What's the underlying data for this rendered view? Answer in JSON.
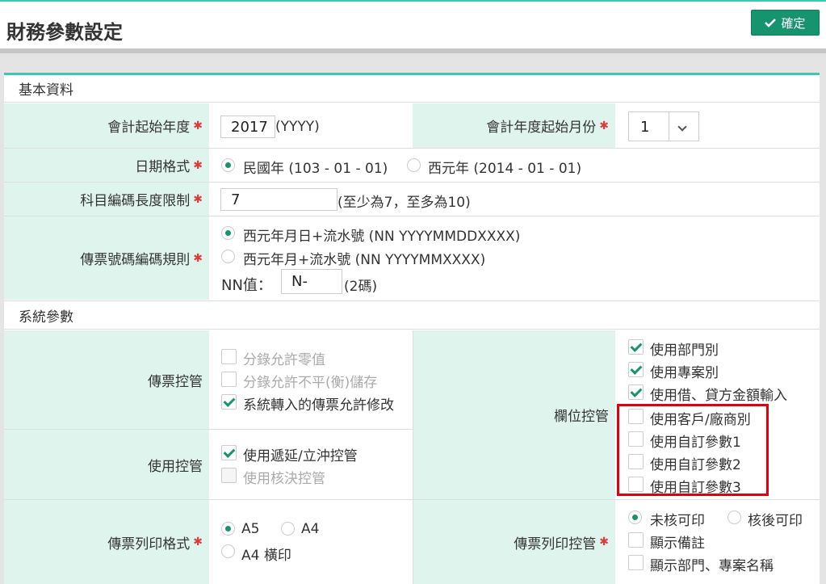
{
  "page": {
    "title": "財務參數設定",
    "confirm_label": "確定"
  },
  "sections": {
    "basic": "基本資料",
    "system": "系統參數"
  },
  "basic": {
    "start_year": {
      "label": "會計起始年度",
      "value": "2017",
      "hint": "(YYYY)"
    },
    "start_month": {
      "label": "會計年度起始月份",
      "value": "1"
    },
    "date_format": {
      "label": "日期格式",
      "options": [
        "民國年 (103 - 01 - 01)",
        "西元年 (2014 - 01 - 01)"
      ]
    },
    "account_length": {
      "label": "科目編碼長度限制",
      "value": "7",
      "hint": "(至少為7，至多為10)"
    },
    "voucher_rule": {
      "label": "傳票號碼編碼規則",
      "options": [
        "西元年月日+流水號 (NN YYYYMMDDXXXX)",
        "西元年月+流水號 (NN YYYYMMXXXX)"
      ],
      "nn_label": "NN值：",
      "nn_value": "N-",
      "nn_hint": "(2碼)"
    }
  },
  "system": {
    "voucher_control": {
      "label": "傳票控管",
      "items": [
        "分錄允許零值",
        "分錄允許不平(衡)儲存",
        "系統轉入的傳票允許修改"
      ]
    },
    "usage_control": {
      "label": "使用控管",
      "items": [
        "使用遞延/立沖控管",
        "使用核決控管"
      ]
    },
    "field_control": {
      "label": "欄位控管",
      "items": [
        "使用部門別",
        "使用專案別",
        "使用借、貸方金額輸入",
        "使用客戶/廠商別",
        "使用自訂參數1",
        "使用自訂參數2",
        "使用自訂參數3"
      ]
    },
    "print_format": {
      "label": "傳票列印格式",
      "options": [
        "A5",
        "A4",
        "A4 橫印"
      ]
    },
    "print_control": {
      "label": "傳票列印控管",
      "radio": [
        "未核可印",
        "核後可印"
      ],
      "items": [
        "顯示備註",
        "顯示部門、專案名稱"
      ]
    }
  },
  "colors": {
    "accent": "#16946e",
    "label_bg": "#e0f4ee",
    "highlight": "#e0000f"
  }
}
